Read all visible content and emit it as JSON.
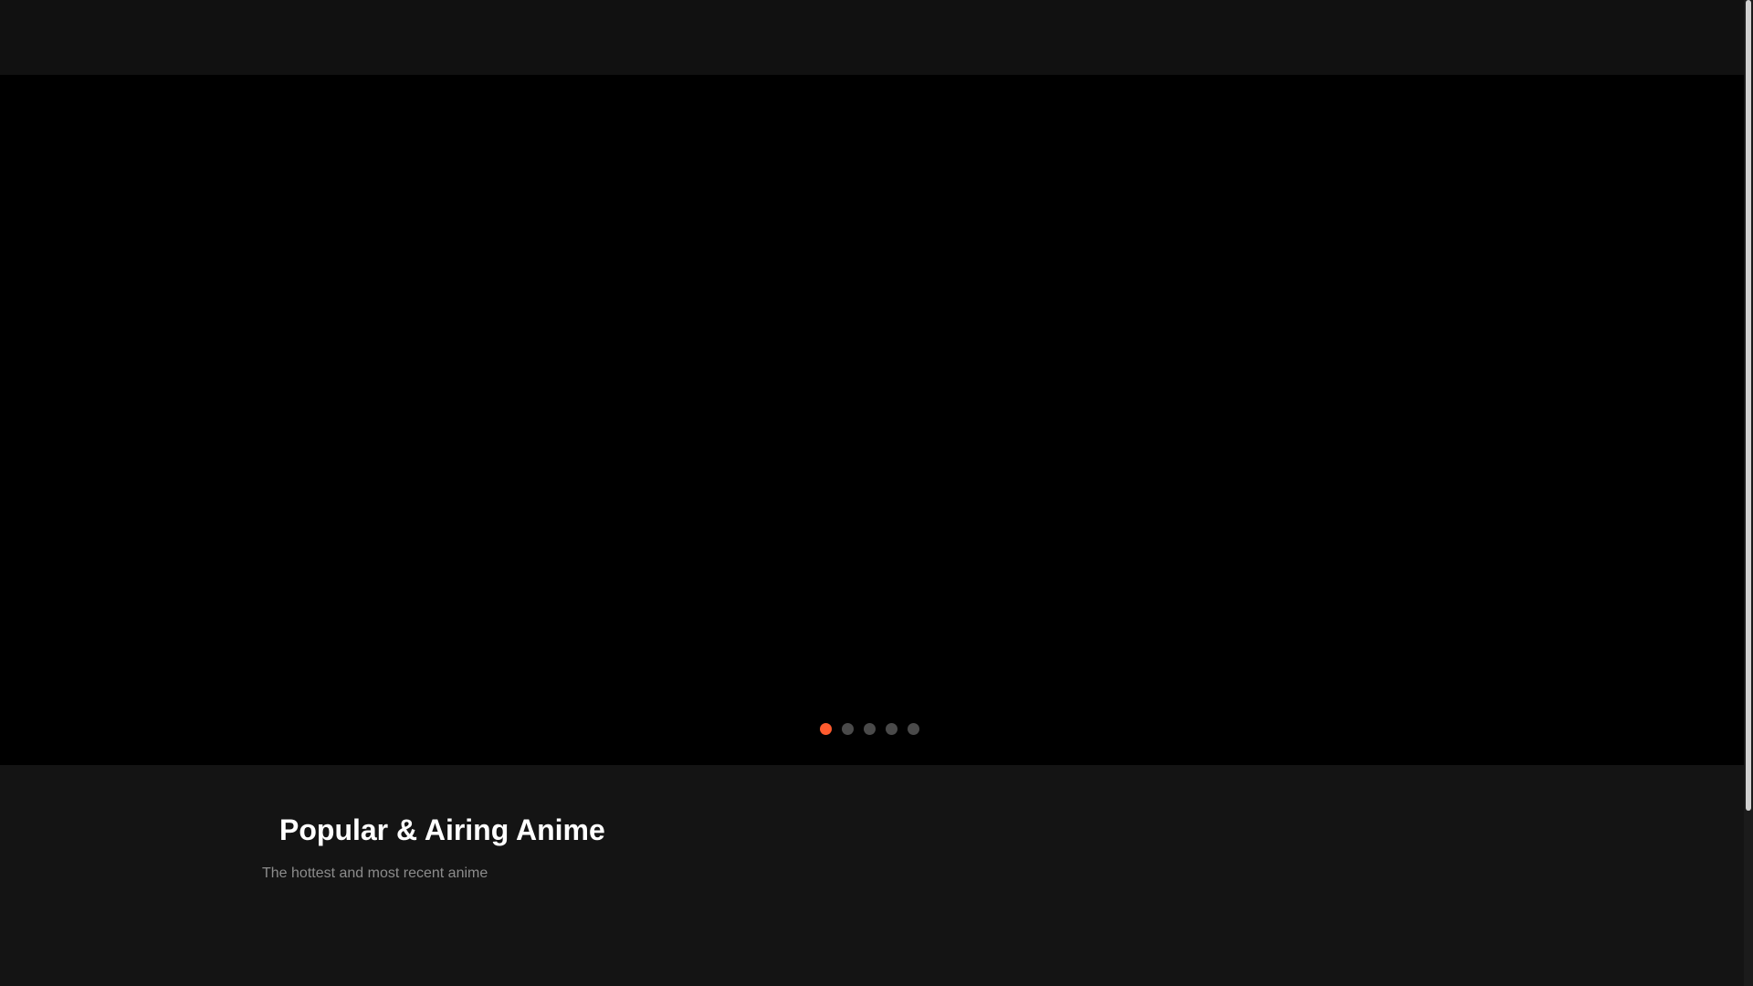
{
  "hero": {
    "slide_count": 5,
    "active_slide": 1
  },
  "section": {
    "title": "Popular & Airing Anime",
    "subtitle": "The hottest and most recent anime"
  },
  "colors": {
    "accent": "#ff5b2e",
    "inactive_dot": "#4a4a4a",
    "background": "#141414",
    "hero_background": "#000000"
  }
}
